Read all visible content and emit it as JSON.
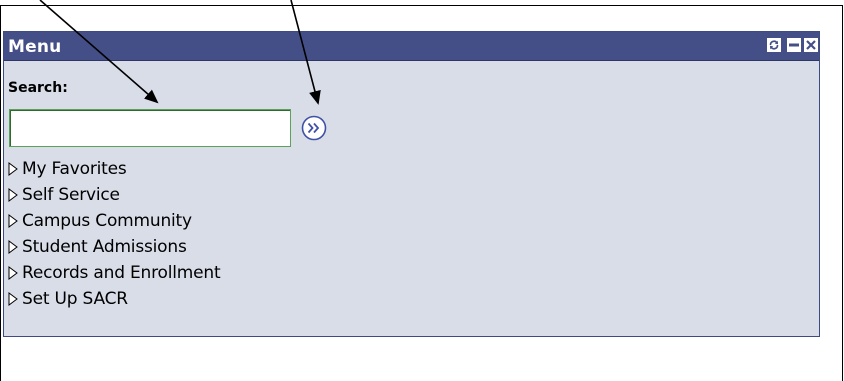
{
  "menu": {
    "title": "Menu",
    "header_controls": [
      {
        "name": "refresh-icon"
      },
      {
        "name": "minimize-icon"
      },
      {
        "name": "close-icon"
      }
    ],
    "search": {
      "label": "Search:",
      "value": "",
      "placeholder": ""
    },
    "go_button_icon": "double-chevron-right-icon",
    "items": [
      {
        "label": "My Favorites"
      },
      {
        "label": "Self Service"
      },
      {
        "label": "Campus Community"
      },
      {
        "label": "Student Admissions"
      },
      {
        "label": "Records and Enrollment"
      },
      {
        "label": "Set Up SACR"
      }
    ]
  },
  "colors": {
    "header_bg": "#454f87",
    "panel_bg": "#d9dde8",
    "arrow": "#000000",
    "go_button": "#3f51a6",
    "input_border": "#5aa15a"
  }
}
